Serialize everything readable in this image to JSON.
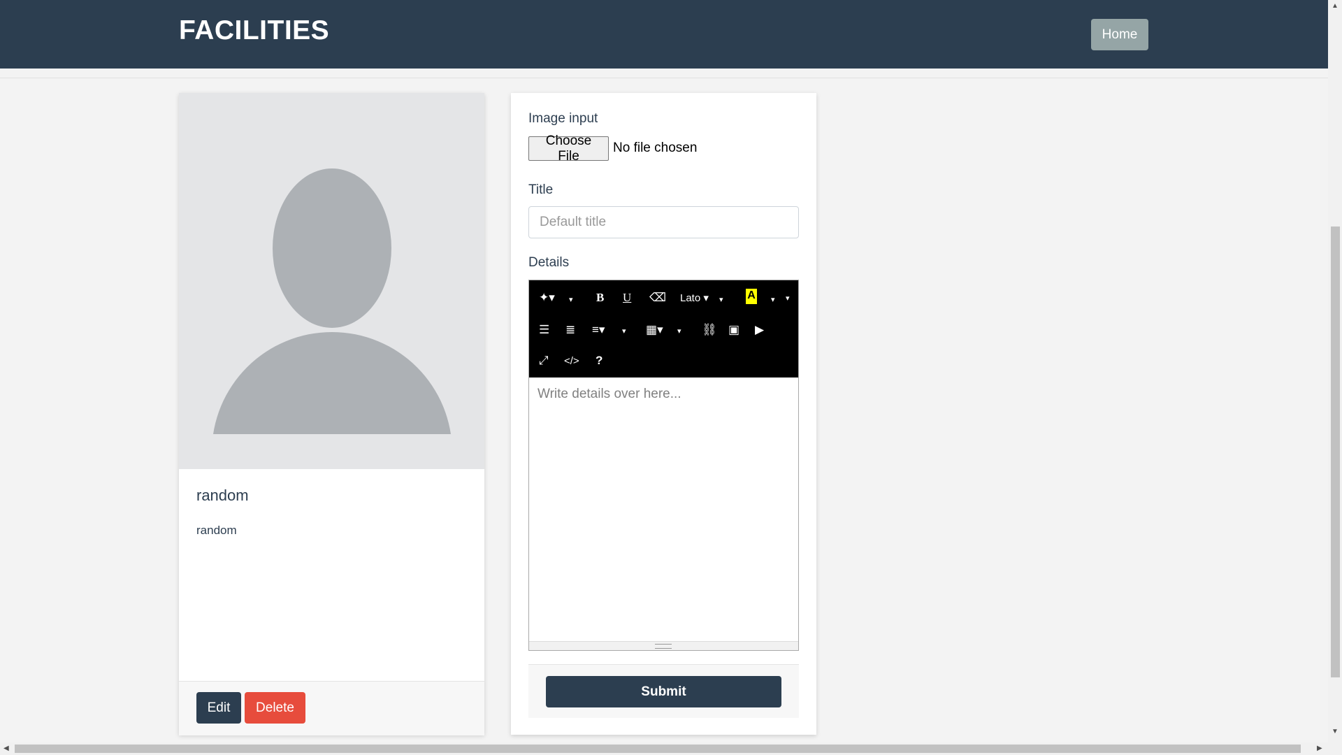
{
  "header": {
    "brand": "FACILITIES",
    "home_label": "Home"
  },
  "facility_card": {
    "title": "random",
    "text": "random",
    "edit_label": "Edit",
    "delete_label": "Delete",
    "image_icon": "person-placeholder-icon"
  },
  "form": {
    "image_label": "Image input",
    "file_button": "Choose File",
    "file_status": "No file chosen",
    "title_label": "Title",
    "title_placeholder": "Default title",
    "details_label": "Details",
    "details_placeholder": "Write details over here...",
    "submit_label": "Submit"
  },
  "editor_toolbar": {
    "font_name": "Lato",
    "bold": "B",
    "underline": "U",
    "code": "</>",
    "help": "?",
    "highlight_color": "#ffff00",
    "icons": [
      "magic-style-icon",
      "bold-icon",
      "underline-icon",
      "eraser-icon",
      "font-family-icon",
      "text-color-icon",
      "unordered-list-icon",
      "ordered-list-icon",
      "align-icon",
      "table-icon",
      "link-icon",
      "picture-icon",
      "video-icon",
      "fullscreen-icon",
      "code-view-icon",
      "help-icon"
    ]
  },
  "colors": {
    "navbar": "#2c3e50",
    "accent_danger": "#e74c3c",
    "secondary": "#95a5a6"
  }
}
